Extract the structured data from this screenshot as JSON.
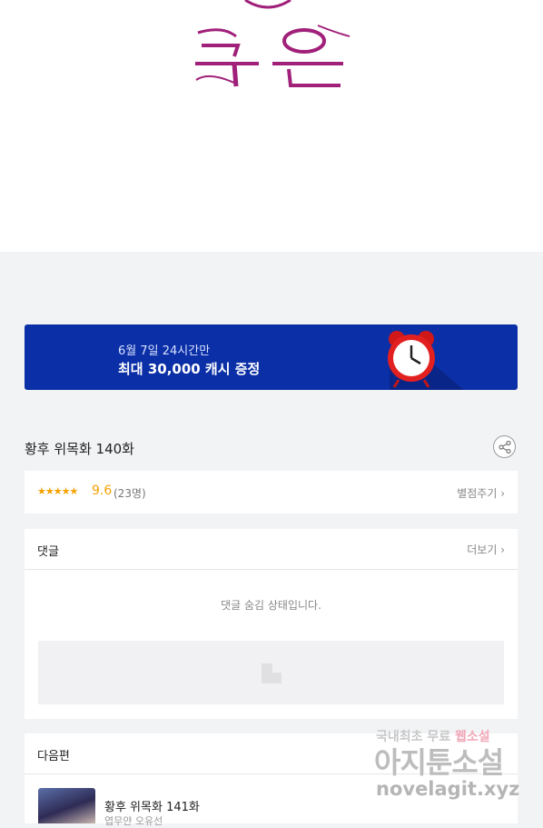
{
  "artwork": {
    "logo_text": "누온"
  },
  "banner": {
    "line1": "6월 7일 24시간만",
    "line2": "최대 30,000 캐시 증정"
  },
  "episode": {
    "title": "황후 위목화 140화"
  },
  "rating": {
    "stars": "★★★★★",
    "score": "9.6",
    "count": "(23명)",
    "rate_link": "별점주기 ›"
  },
  "comments": {
    "heading": "댓글",
    "more_link": "더보기 ›",
    "hidden_message": "댓글 숨김 상태입니다."
  },
  "next": {
    "heading": "다음편",
    "title": "황후 위목화 141화",
    "subtitle": "엽무얀 오유선"
  },
  "watermark": {
    "line1": "국내최초 무료",
    "line1_highlight": "웹소설",
    "line2": "아지툰소설",
    "line3": "novelagit.xyz"
  },
  "colors": {
    "banner_bg": "#0b2fa6",
    "star": "#f5a100",
    "logo": "#a0207a"
  }
}
